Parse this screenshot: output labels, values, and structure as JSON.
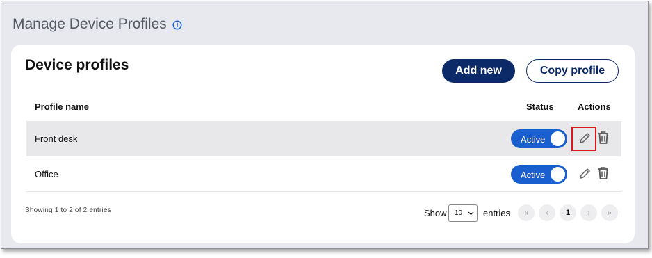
{
  "page": {
    "title": "Manage Device Profiles",
    "info_icon": "info-icon"
  },
  "card": {
    "title": "Device profiles",
    "add_button": "Add new",
    "copy_button": "Copy profile"
  },
  "table": {
    "headers": {
      "name": "Profile name",
      "status": "Status",
      "actions": "Actions"
    },
    "rows": [
      {
        "name": "Front desk",
        "status": "Active",
        "edit_icon": "pencil-icon",
        "delete_icon": "trash-icon",
        "highlighted_action": "edit"
      },
      {
        "name": "Office",
        "status": "Active",
        "edit_icon": "pencil-icon",
        "delete_icon": "trash-icon"
      }
    ]
  },
  "footer": {
    "showing_text": "Showing 1 to 2 of 2 entries",
    "show_label": "Show",
    "page_size": "10",
    "entries_label": "entries",
    "pagination": {
      "first": "«",
      "prev": "‹",
      "current": "1",
      "next": "›",
      "last": "»"
    }
  },
  "colors": {
    "primary": "#0c2a68",
    "toggle": "#1a5fd0",
    "highlight": "#e0141e",
    "selected_row": "#e8e8ea"
  }
}
